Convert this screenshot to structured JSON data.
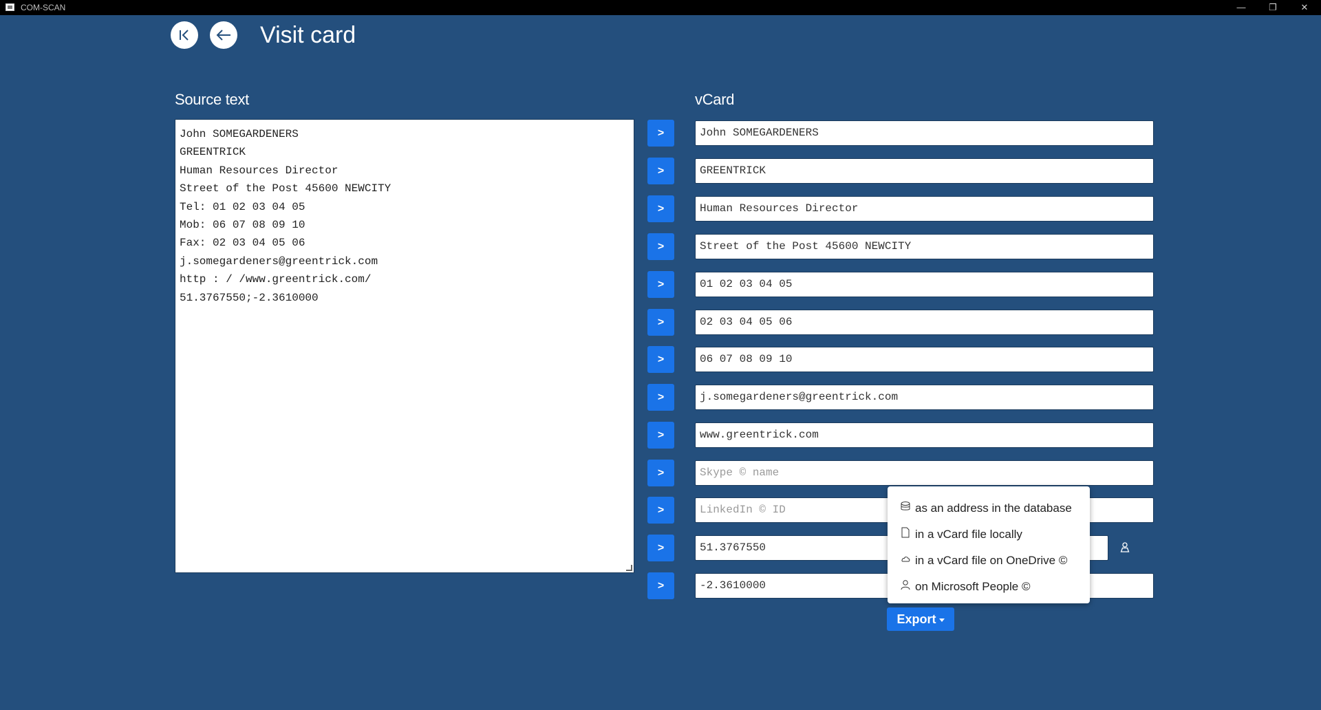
{
  "window": {
    "title": "COM-SCAN",
    "minimize": "—",
    "restore": "❐",
    "close": "✕"
  },
  "header": {
    "title": "Visit card"
  },
  "source": {
    "label": "Source text",
    "lines": [
      "John SOMEGARDENERS",
      "GREENTRICK",
      "Human Resources Director",
      "Street of the Post 45600 NEWCITY",
      "Tel: 01 02 03 04 05",
      "Mob: 06 07 08 09 10",
      "Fax: 02 03 04 05 06",
      "j.somegardeners@greentrick.com",
      "http : / /www.greentrick.com/",
      "51.3767550;-2.3610000"
    ]
  },
  "vcard": {
    "label": "vCard",
    "copy_label": ">",
    "fields": [
      {
        "value": "John SOMEGARDENERS"
      },
      {
        "value": "GREENTRICK"
      },
      {
        "value": "Human Resources Director"
      },
      {
        "value": "Street of the Post 45600 NEWCITY"
      },
      {
        "value": "01 02 03 04 05"
      },
      {
        "value": "02 03 04 05 06"
      },
      {
        "value": "06 07 08 09 10"
      },
      {
        "value": "j.somegardeners@greentrick.com"
      },
      {
        "value": "www.greentrick.com"
      },
      {
        "placeholder": "Skype © name"
      },
      {
        "placeholder": "LinkedIn © ID"
      },
      {
        "value": "51.3767550"
      },
      {
        "value": "-2.3610000"
      }
    ]
  },
  "export": {
    "label": "Export",
    "menu": [
      {
        "label": "as an address in the database",
        "icon": "database-icon"
      },
      {
        "label": "in a vCard file locally",
        "icon": "file-icon"
      },
      {
        "label": "in a vCard file on OneDrive ©",
        "icon": "cloud-icon"
      },
      {
        "label": "on Microsoft People ©",
        "icon": "person-icon"
      }
    ]
  },
  "colors": {
    "background": "#244f7d",
    "accent": "#1a73e8"
  }
}
